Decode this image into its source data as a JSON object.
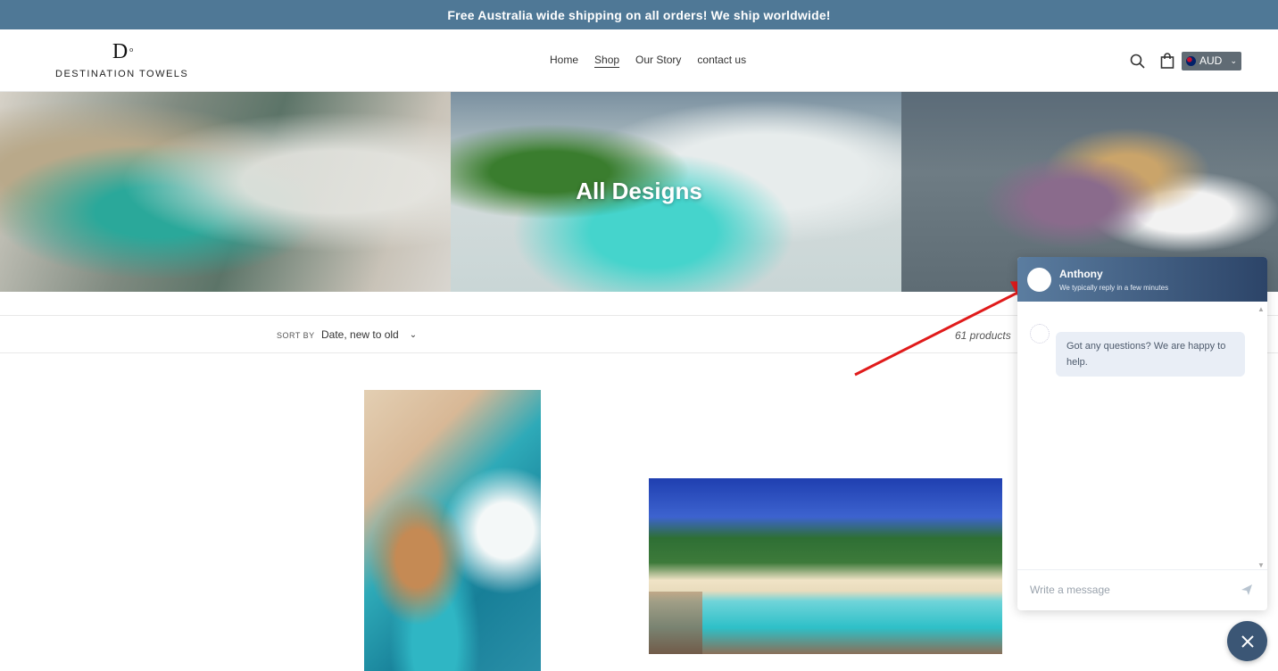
{
  "announcement": {
    "text": "Free Australia wide shipping on all orders! We ship worldwide!"
  },
  "header": {
    "logo_mark": "D",
    "logo_sup": "o",
    "logo_text": "DESTINATION TOWELS",
    "nav": [
      {
        "label": "Home",
        "active": false
      },
      {
        "label": "Shop",
        "active": true
      },
      {
        "label": "Our Story",
        "active": false
      },
      {
        "label": "contact us",
        "active": false
      }
    ],
    "currency": "AUD"
  },
  "hero": {
    "title": "All Designs"
  },
  "filters": {
    "sort_label": "SORT BY",
    "sort_value": "Date, new to old",
    "product_count": "61 products"
  },
  "chat": {
    "agent_name": "Anthony",
    "agent_status": "We typically reply in a few minutes",
    "message": "Got any questions? We are happy to help.",
    "input_placeholder": "Write a message"
  },
  "colors": {
    "announcement_bg": "#4f7896",
    "chat_header_start": "#5b7da0",
    "chat_header_end": "#2c4468",
    "arrow": "#e01b1b"
  }
}
